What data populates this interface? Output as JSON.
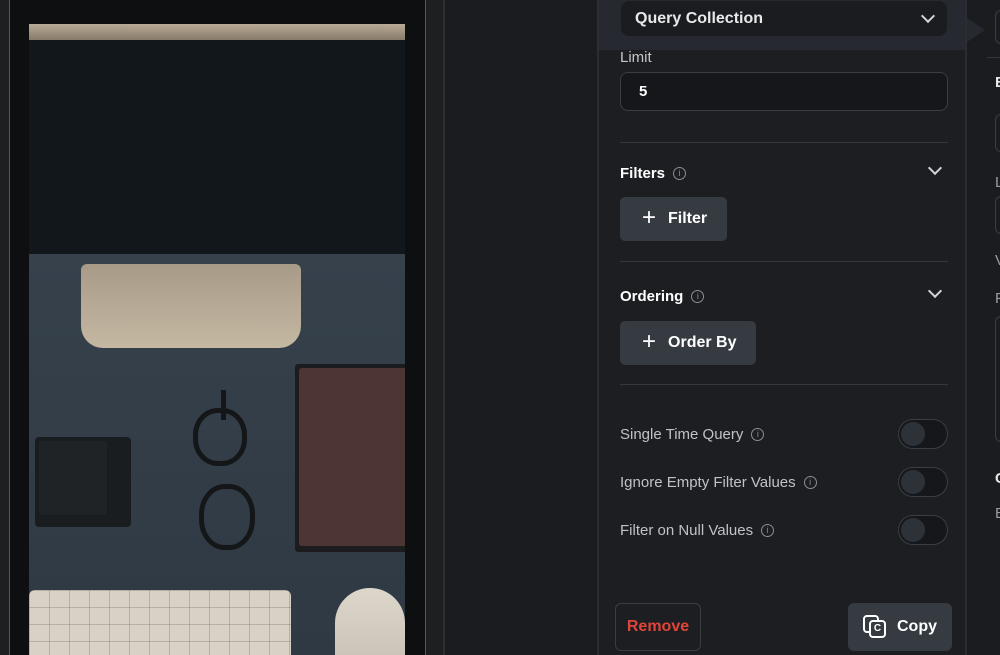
{
  "panel": {
    "query_type": "Query Collection",
    "limit_label": "Limit",
    "limit_value": "5",
    "filters_title": "Filters",
    "filter_button": "Filter",
    "ordering_title": "Ordering",
    "order_by_button": "Order By",
    "toggles": [
      {
        "label": "Single Time Query",
        "on": false
      },
      {
        "label": "Ignore Empty Filter Values",
        "on": false
      },
      {
        "label": "Filter on Null Values",
        "on": false
      }
    ],
    "remove_button": "Remove",
    "copy_button": "Copy"
  },
  "right_strip": {
    "letters": [
      "E",
      "L",
      "V",
      "P",
      "C",
      "E"
    ]
  },
  "colors": {
    "remove_text": "#e0453a",
    "panel_bg": "#1c1e21",
    "button_bg": "#363b42",
    "device_border": "#2a6d5d"
  }
}
